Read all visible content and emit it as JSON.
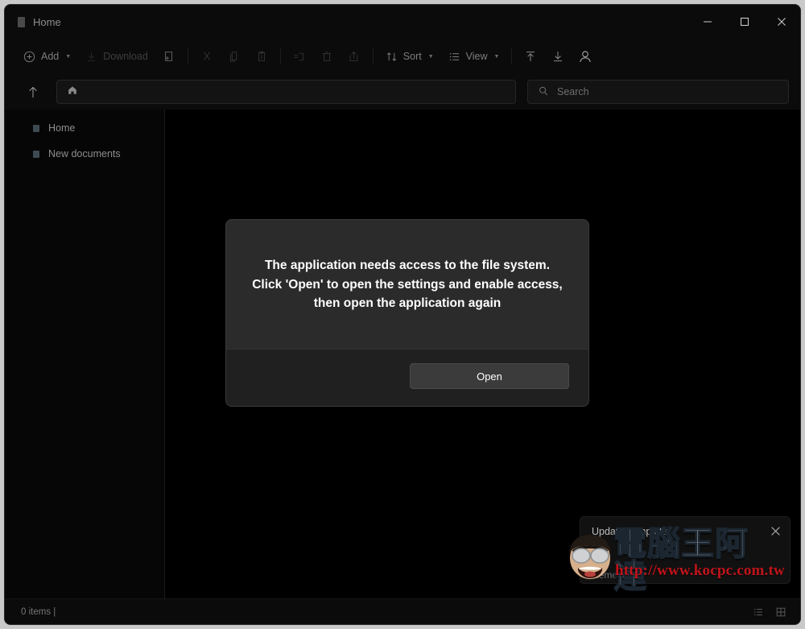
{
  "window": {
    "tab_title": "Home",
    "controls": {
      "minimize": "Minimize",
      "maximize": "Maximize",
      "close": "Close"
    }
  },
  "toolbar": {
    "add_label": "Add",
    "download_label": "Download",
    "new_folder_label": "New folder",
    "cut_label": "Cut",
    "copy_label": "Copy",
    "paste_label": "Paste",
    "rename_label": "Rename",
    "delete_label": "Delete",
    "share_label": "Share",
    "sort_label": "Sort",
    "view_label": "View",
    "upload_label": "Upload",
    "download_all_label": "Download",
    "account_label": "Account"
  },
  "address": {
    "up_label": "Up",
    "breadcrumb": "",
    "home_icon": "home-icon"
  },
  "search": {
    "placeholder": "Search",
    "value": ""
  },
  "sidebar": {
    "items": [
      {
        "label": "Home"
      },
      {
        "label": "New documents"
      }
    ]
  },
  "dialog": {
    "message": "The application needs access to the file system.\nClick 'Open' to open the settings and enable access,\nthen open the application again",
    "open_label": "Open"
  },
  "toast": {
    "title": "Update complete",
    "subtitle": "Removed",
    "close_label": "Close"
  },
  "watermark": {
    "cjk_text": "電腦王阿達",
    "url_text": "http://www.kocpc.com.tw"
  },
  "statusbar": {
    "item_count": "0 items |",
    "list_view_label": "List view",
    "grid_view_label": "Grid view"
  },
  "colors": {
    "window_bg": "#0a0a0a",
    "content_bg": "#000000",
    "dialog_bg": "#2b2b2b",
    "dialog_footer_bg": "#202020",
    "accent_text": "#ffffff",
    "muted_text": "#8d8d8d",
    "watermark_red": "#c0141a"
  }
}
